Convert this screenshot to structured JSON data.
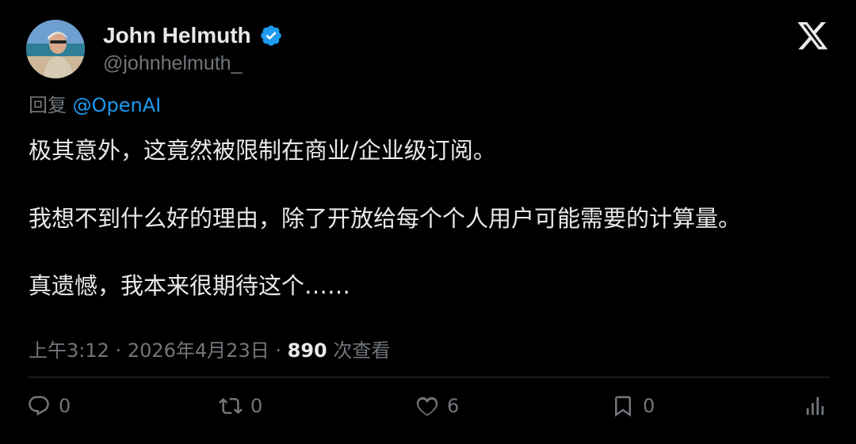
{
  "author": {
    "display_name": "John Helmuth",
    "handle": "@johnhelmuth_"
  },
  "reply": {
    "prefix": "回复",
    "mention": "@OpenAI"
  },
  "body": {
    "line1": "极其意外，这竟然被限制在商业/企业级订阅。",
    "line2": "我想不到什么好的理由，除了开放给每个个人用户可能需要的计算量。",
    "line3": "真遗憾，我本来很期待这个……"
  },
  "meta": {
    "time": "上午3:12",
    "date": "2026年4月23日",
    "separator": "·",
    "views_count": "890",
    "views_label": "次查看"
  },
  "actions": {
    "replies": "0",
    "reposts": "0",
    "likes": "6",
    "bookmarks": "0"
  },
  "colors": {
    "background": "#000000",
    "text": "#e7e9ea",
    "secondary": "#71767b",
    "accent": "#1d9bf0"
  }
}
